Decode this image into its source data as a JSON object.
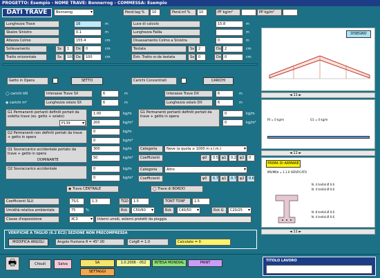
{
  "window": {
    "title": "PROGETTO: Esempio - NOME TRAVE: Bonnerrog - COMMESSA: Esempio"
  },
  "header": {
    "title": "DATI TRAVE",
    "beam_select": "Bonnerog",
    "pend_label": "Pend.tag %",
    "pend_value": "10",
    "pend2_label": "Pend.inf %",
    "pend2_value": "10",
    "pf_label": "PF kg/m²",
    "pp_label": "PP kg/m²"
  },
  "left": {
    "rows": [
      {
        "label": "Lunghezza Trave",
        "value": "16",
        "unit": "m"
      },
      {
        "label": "Sbalzo Sinistro",
        "value": "0.1",
        "unit": "m"
      },
      {
        "label": "Altezza Colmo",
        "value": "155.4",
        "unit": "cm"
      },
      {
        "label": "Sollevamento",
        "sx_label": "Sx",
        "sx_value": "1",
        "dx_label": "Dx",
        "dx_value": "0",
        "unit": "cm"
      },
      {
        "label": "Tratto orizzontale",
        "sx_label": "Sx",
        "sx_value": "100",
        "dx_label": "Dx",
        "dx_value": "100",
        "unit": "cm"
      }
    ],
    "gotto_label": "Getto in Opera",
    "setto_button": "SETTO",
    "carichi_kn": "carichi kN",
    "carichi_m2": "carichi m²",
    "interasse_sx_label": "Interasse Trave SX",
    "interasse_sx_value": "6",
    "interasse_sx_unit": "m",
    "solaio_sx_label": "Lunghezza solaio SX",
    "solaio_sx_value": "6",
    "solaio_sx_unit": "m",
    "g1_label": "G1 Permanenti portanti definiti portati da soletta trave (es. getto + soiato)",
    "g1_sel": "P139",
    "g1_v1": "1.00",
    "g1_u1": "kg/m",
    "g1_v2": "200",
    "g1_u2": "kg/m²",
    "g2_label": "G2 Permanenti non definiti portati da trave + getto in opera",
    "g2_v1": "0",
    "g2_u1": "kg/m",
    "g2_v2": "0",
    "g2_u2": "kg/m²",
    "q1_label": "Q1 Sovraccarico accidentale portato da trave + getto in opera",
    "q1_tag": "DOMINANTE",
    "q1_v1": "300",
    "q1_u1": "kg/m",
    "q1_v2": "50",
    "q1_u2": "kg/m²",
    "q2_label": "Q2 Sovraccarico accidentale",
    "q2_v1": "0",
    "q2_u1": "kg/m",
    "q2_v2": "0",
    "q2_u2": "kg/m²",
    "trave_centrale": "Trave CENTRALE",
    "trave_bordo": "Trave di BORDO",
    "cls_label": "Coefficienti SLU",
    "cls_v": "75/1",
    "cls_v2": "1.3",
    "gtot_label": "TGD",
    "gtot_v": "1.5",
    "tonf_label": "TONT TONF",
    "tonf_v": "1.5",
    "umid_label": "Umidità relativa ambientale",
    "umid_v": "75",
    "umid_u": "%",
    "reck_label": "Rck",
    "reck_v": "C50/60",
    "reck2_label": "Rck",
    "reck2_v": "C40/50",
    "reck3_label": "Rck G",
    "reck3_v": "C20/25",
    "classe_label": "Classe d'esposizione",
    "classe_v": "XC3",
    "classe_desc": "Interni umidi, esterni protetti da pioggia",
    "verif_title": "VERIFICHE A TAGLIO (6.2 EC2) SEZIONE NON PRECOMPRESSA",
    "verif_btn": "MODIFICA ANGOLI",
    "verif_angolo": "Angolo Puntone θ = 45°.00",
    "verif_cotg": "Cotgθ = 1.0",
    "verif_calc": "Calcolato = 0"
  },
  "mid": {
    "luce_label": "Luce di calcolo",
    "luce_value": "15.8",
    "luce_unit": "m",
    "lung_label": "Lunghezza Falda",
    "lung_value": "",
    "lung_unit": "m",
    "disass_label": "Disassamento Colmo a Sinistra",
    "disass_value": "0",
    "disass_unit": "m",
    "testata_label": "Testata",
    "testata_sx": "Sx",
    "testata_sxv": "2",
    "testata_dx": "Dx",
    "testata_dxv": "2",
    "testata_unit": "cm",
    "estr_label": "Estr. Tratto or.da testata",
    "estr_sx": "Sx",
    "estr_sxv": "0",
    "estr_dx": "Dx",
    "estr_dxv": "0",
    "estr_unit": "cm",
    "carichi_conc": "Carichi Concentrati",
    "carichi_btn": "CARICHI",
    "interasse_dx_label": "Interasse Trave DX",
    "interasse_dx_value": "6",
    "interasse_dx_unit": "m",
    "solaio_dx_label": "Lunghezza solaio DX",
    "solaio_dx_value": "6",
    "solaio_dx_unit": "m",
    "g1dx_label": "G1 Permanenti portanti definiti portati da trave + getto in opera",
    "g1dx_v1": "0",
    "g1dx_u1": "kg/m",
    "g1dx_v2": "0",
    "g1dx_u2": "kg/m²",
    "cat1_label": "Categoria",
    "cat1_value": "Neve (a quota ≥ 1000 m s.l.m.)",
    "coef1_label": "Coefficienti",
    "psi0": "ψ0",
    "psi0v": "0.5",
    "psi1": "ψ1",
    "psi1v": "0.2",
    "psi2": "ψ2",
    "psi2v": "0",
    "cat2_label": "Categoria",
    "cat2_value": "Altro",
    "coef2_label": "Coefficienti",
    "psi0b": "ψ0",
    "psi0bv": "0.7",
    "psi1b": "ψ1",
    "psi1bv": "0.7",
    "psi2b": "ψ2",
    "psi2bv": "0.6"
  },
  "right": {
    "disegno_btn": "DISEGNO",
    "nav1": "11",
    "nav2": "11",
    "nav3": "11",
    "schema_label1": "Rf = 0 kg/m",
    "schema_label2": "G1 = 0 kg/m",
    "prima_btn": "PRIMA DI ARMARE",
    "verif_text": "MR/MRd = 1.1.0 VERIFICATO",
    "section_labels": [
      "N. 4 trefoli Ø 0.6",
      "N. 4 trefoli Ø 0.6",
      "N. 8 trefoli Ø 0.6",
      "N. 4 trefoli Ø 0.6"
    ],
    "titolo_label": "TITOLO LAVORO"
  },
  "footer": {
    "chiudi": "Chiudi",
    "salva": "Salva",
    "tags": [
      {
        "t": "SA",
        "c": "#f7e56b"
      },
      {
        "t": "1.0.2006 - 052",
        "c": "#f3f7a0"
      },
      {
        "t": "INTESA MONDIAL",
        "c": "#8ee07c"
      },
      {
        "t": "PRINT",
        "c": "#c79ef3"
      }
    ],
    "tab_bottom": "SETTAGGI",
    "colors": {
      "accent": "#1d3d86",
      "panel": "#1c7186"
    }
  }
}
